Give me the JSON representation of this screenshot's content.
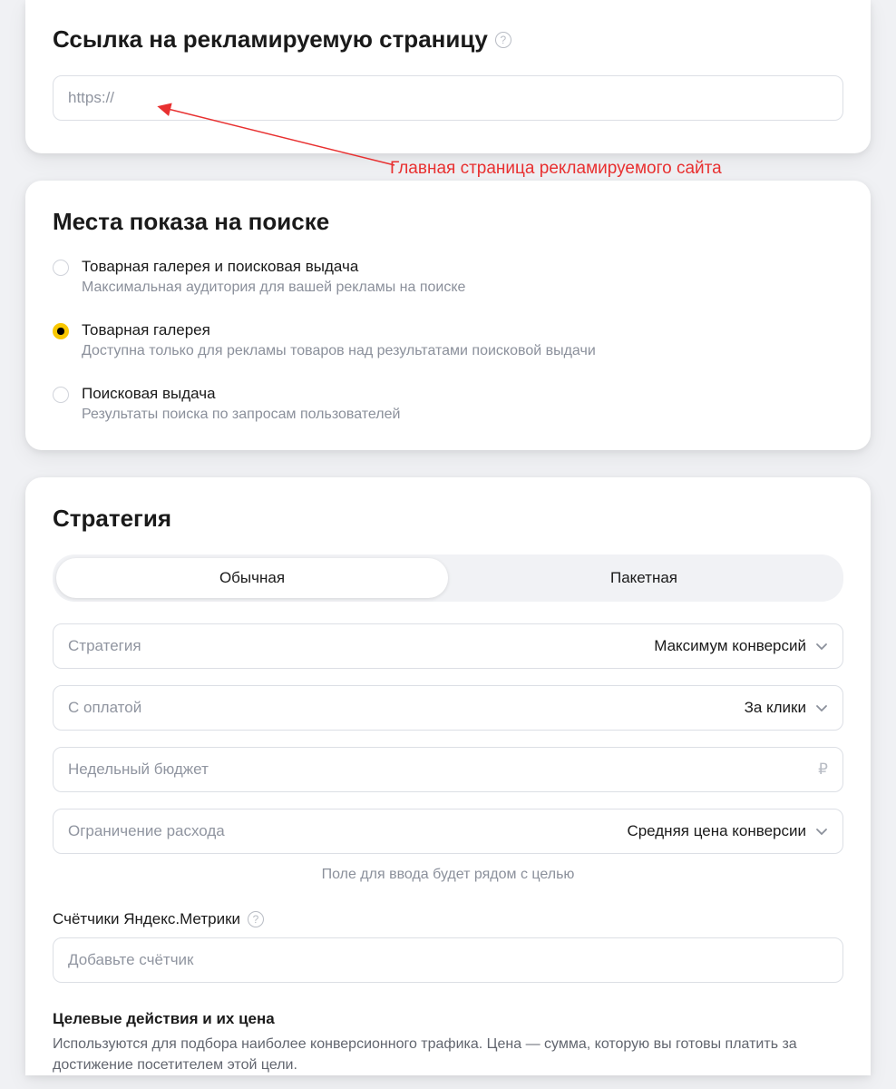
{
  "link_section": {
    "title": "Ссылка на рекламируемую страницу",
    "placeholder": "https://"
  },
  "annotation": "Главная страница рекламируемого сайта",
  "places": {
    "title": "Места показа на поиске",
    "options": [
      {
        "title": "Товарная галерея и поисковая выдача",
        "desc": "Максимальная аудитория для вашей рекламы на поиске",
        "selected": false
      },
      {
        "title": "Товарная галерея",
        "desc": "Доступна только для рекламы товаров над результатами поисковой выдачи",
        "selected": true
      },
      {
        "title": "Поисковая выдача",
        "desc": "Результаты поиска по запросам пользователей",
        "selected": false
      }
    ]
  },
  "strategy": {
    "title": "Стратегия",
    "tabs": [
      {
        "label": "Обычная",
        "active": true
      },
      {
        "label": "Пакетная",
        "active": false
      }
    ],
    "rows": {
      "strategy": {
        "label": "Стратегия",
        "value": "Максимум конверсий"
      },
      "payment": {
        "label": "С оплатой",
        "value": "За клики"
      },
      "budget": {
        "label": "Недельный бюджет",
        "currency": "₽"
      },
      "limit": {
        "label": "Ограничение расхода",
        "value": "Средняя цена конверсии"
      }
    },
    "hint": "Поле для ввода будет рядом с целью",
    "metrics": {
      "label": "Счётчики Яндекс.Метрики",
      "placeholder": "Добавьте счётчик"
    },
    "goals": {
      "title": "Целевые действия и их цена",
      "desc": "Используются для подбора наиболее конверсионного трафика. Цена — сумма, которую вы готовы платить за достижение посетителем этой цели."
    }
  }
}
